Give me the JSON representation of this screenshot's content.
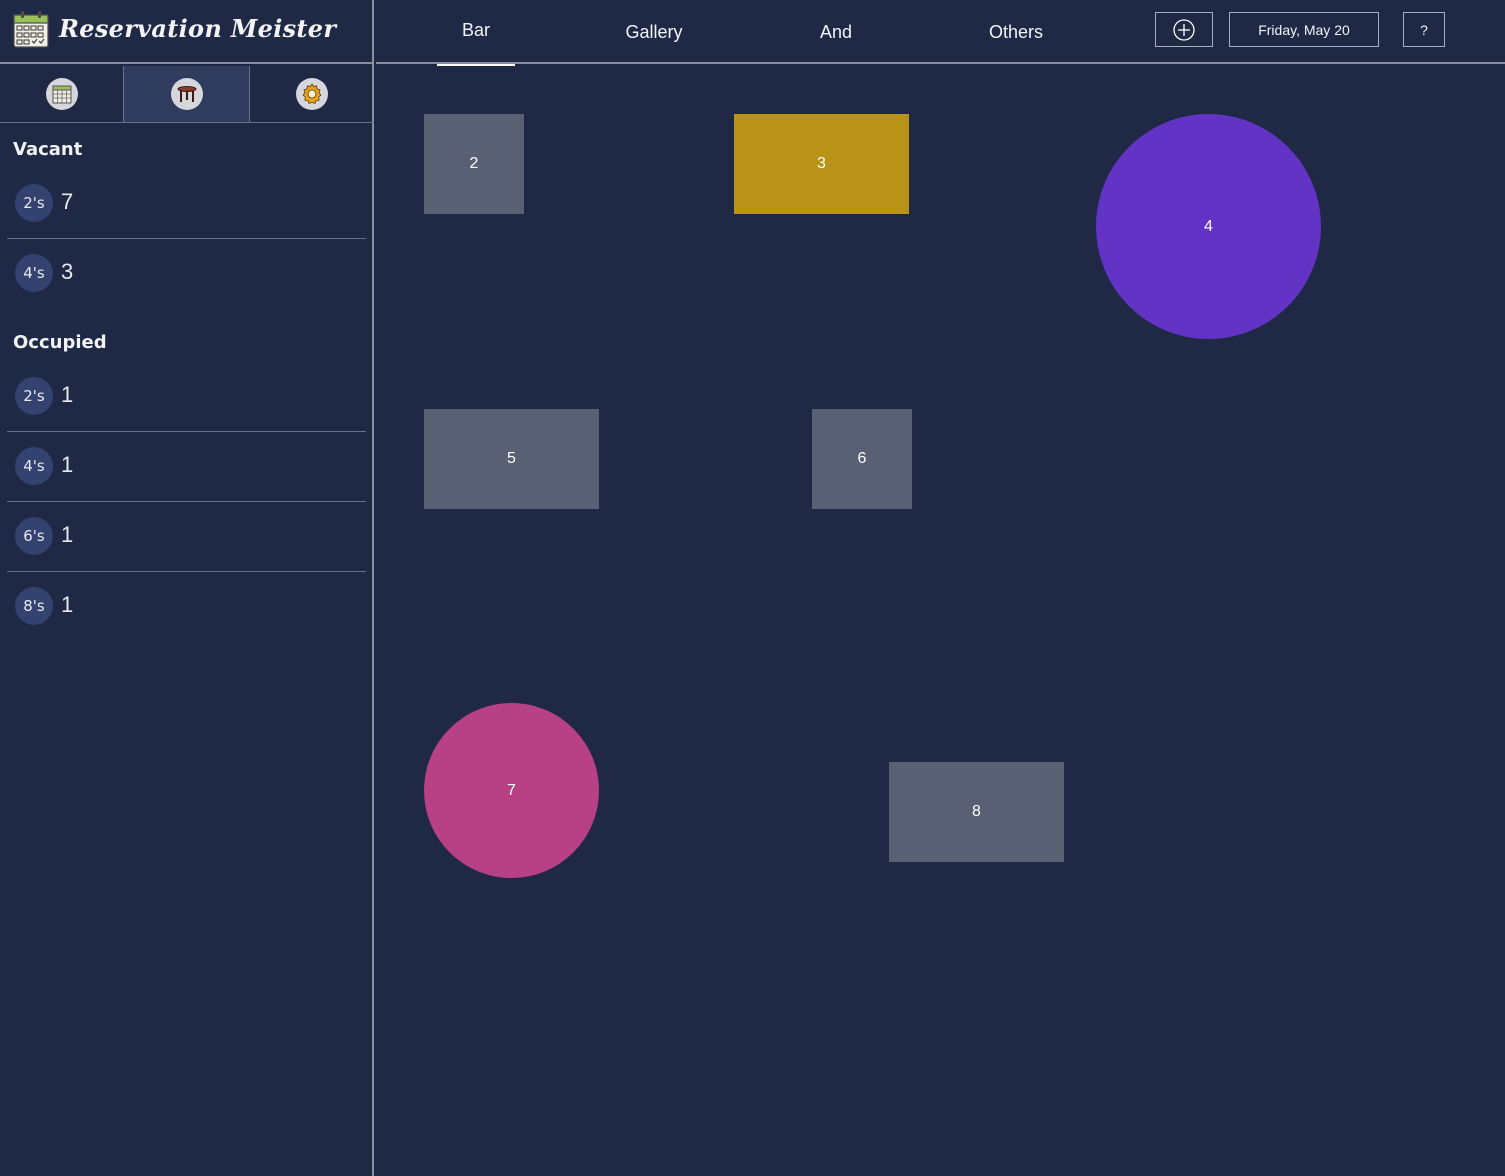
{
  "app": {
    "title": "Reservation Meister"
  },
  "sidebar": {
    "mode_tabs": [
      {
        "name": "calendar-icon",
        "active": false
      },
      {
        "name": "table-icon",
        "active": true
      },
      {
        "name": "gear-icon",
        "active": false
      }
    ],
    "vacant": {
      "title": "Vacant",
      "rows": [
        {
          "size": "2's",
          "count": "7"
        },
        {
          "size": "4's",
          "count": "3"
        }
      ]
    },
    "occupied": {
      "title": "Occupied",
      "rows": [
        {
          "size": "2's",
          "count": "1"
        },
        {
          "size": "4's",
          "count": "1"
        },
        {
          "size": "6's",
          "count": "1"
        },
        {
          "size": "8's",
          "count": "1"
        }
      ]
    }
  },
  "topnav": {
    "tabs": [
      {
        "label": "Bar",
        "active": true
      },
      {
        "label": "Gallery",
        "active": false
      },
      {
        "label": "And",
        "active": false
      },
      {
        "label": "Others",
        "active": false
      }
    ],
    "add_icon": "plus-circle-icon",
    "date_label": "Friday, May 20",
    "help_label": "?"
  },
  "floor": {
    "tables": [
      {
        "label": "2",
        "shape": "square",
        "color": "#5a6074"
      },
      {
        "label": "3",
        "shape": "rect",
        "color": "#b89318"
      },
      {
        "label": "4",
        "shape": "circle",
        "color": "#6233c4"
      },
      {
        "label": "5",
        "shape": "rect",
        "color": "#5a6074"
      },
      {
        "label": "6",
        "shape": "square",
        "color": "#5a6074"
      },
      {
        "label": "7",
        "shape": "circle",
        "color": "#b84084"
      },
      {
        "label": "8",
        "shape": "rect",
        "color": "#5a6074"
      }
    ]
  },
  "colors": {
    "background": "#1f2945",
    "badge": "#33426e",
    "active_tab": "#2f3c5e"
  }
}
